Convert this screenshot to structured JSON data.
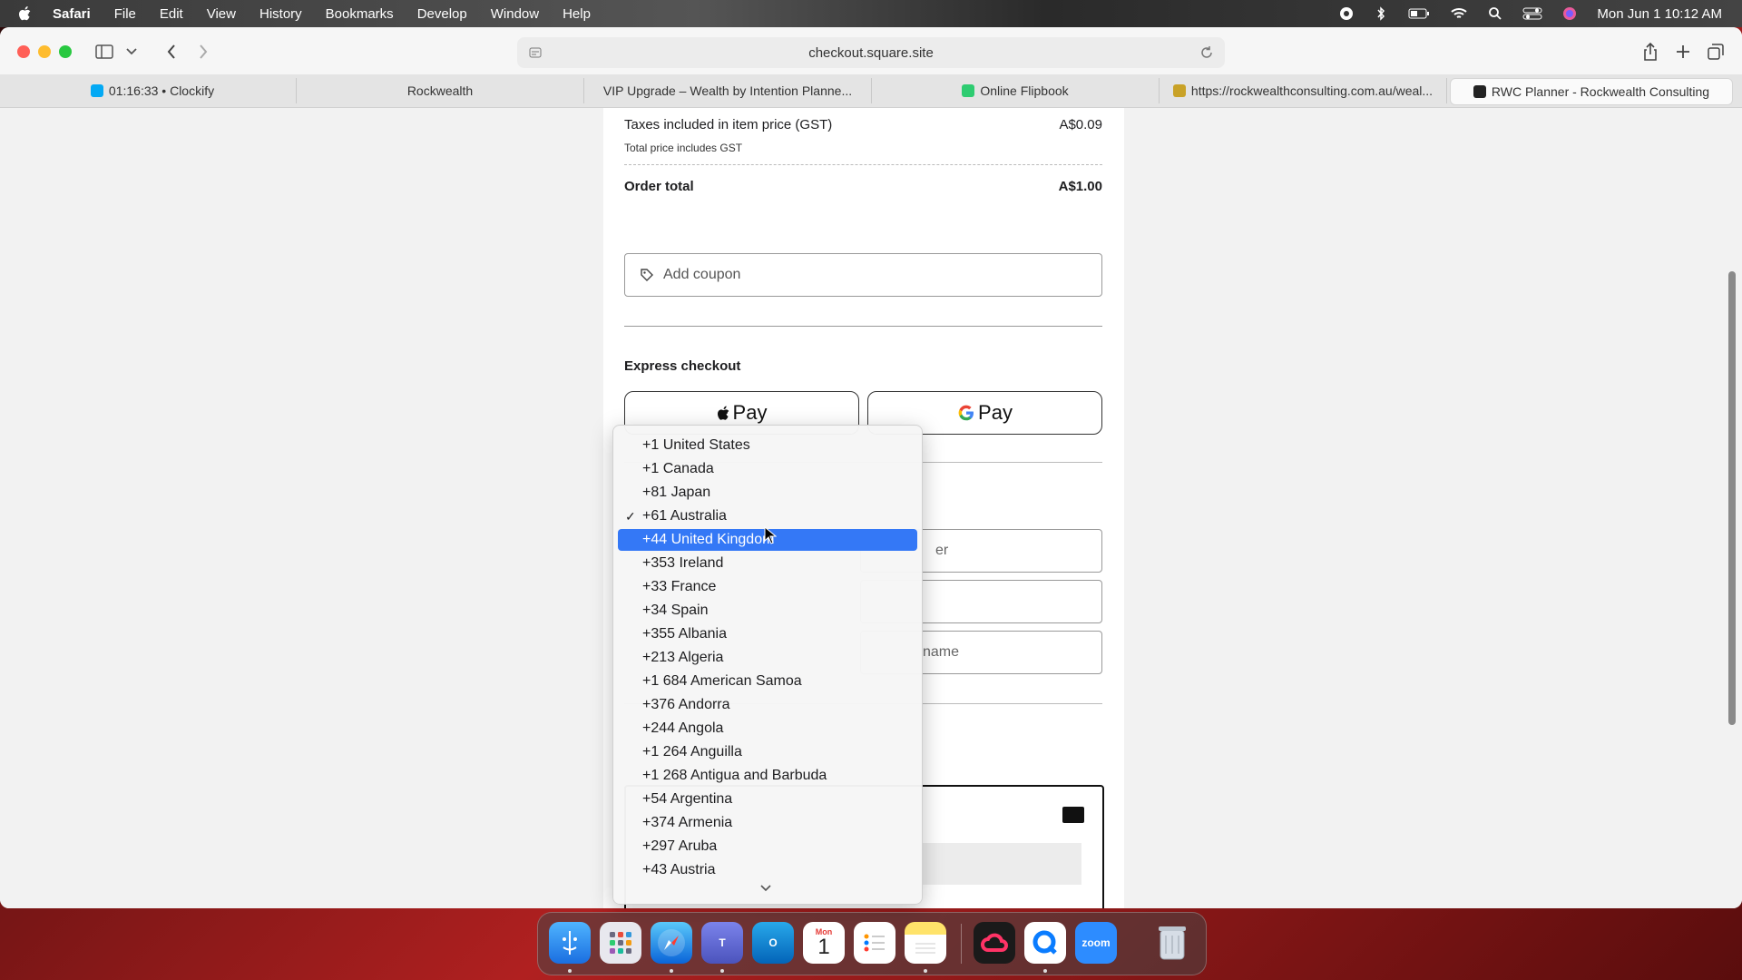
{
  "menubar": {
    "app": "Safari",
    "items": [
      "File",
      "Edit",
      "View",
      "History",
      "Bookmarks",
      "Develop",
      "Window",
      "Help"
    ],
    "clock": "Mon Jun 1  10:12 AM"
  },
  "browser": {
    "url": "checkout.square.site",
    "tabs": [
      {
        "label": "01:16:33 • Clockify",
        "favicon_color": "#03a9f4"
      },
      {
        "label": "Rockwealth",
        "favicon_color": ""
      },
      {
        "label": "VIP Upgrade – Wealth by Intention Planne...",
        "favicon_color": ""
      },
      {
        "label": "Online Flipbook",
        "favicon_color": "#2ecc71"
      },
      {
        "label": "https://rockwealthconsulting.com.au/weal...",
        "favicon_color": "#c9a227"
      },
      {
        "label": "RWC Planner - Rockwealth Consulting",
        "favicon_color": "#222222"
      }
    ]
  },
  "checkout": {
    "tax_label": "Taxes included in item price (GST)",
    "tax_value": "A$0.09",
    "tax_note": "Total price includes GST",
    "total_label": "Order total",
    "total_value": "A$1.00",
    "coupon_placeholder": "Add coupon",
    "express_label": "Express checkout",
    "apple_pay": "Pay",
    "google_pay": "Pay",
    "phone_placeholder_tail": "er",
    "lastname_placeholder_tail": "name"
  },
  "country_dropdown": {
    "selected": "+61 Australia",
    "highlighted": "+44 United Kingdom",
    "options": [
      "+1 United States",
      "+1 Canada",
      "+81 Japan",
      "+61 Australia",
      "+44 United Kingdom",
      "+353 Ireland",
      "+33 France",
      "+34 Spain",
      "+355 Albania",
      "+213 Algeria",
      "+1 684 American Samoa",
      "+376 Andorra",
      "+244 Angola",
      "+1 264 Anguilla",
      "+1 268 Antigua and Barbuda",
      "+54 Argentina",
      "+374 Armenia",
      "+297 Aruba",
      "+43 Austria"
    ],
    "checkmark": "✓"
  },
  "dock": {
    "calendar_month": "Mon",
    "calendar_day": "1",
    "zoom_label": "zoom"
  },
  "colors": {
    "accent_highlight": "#3478f6"
  }
}
